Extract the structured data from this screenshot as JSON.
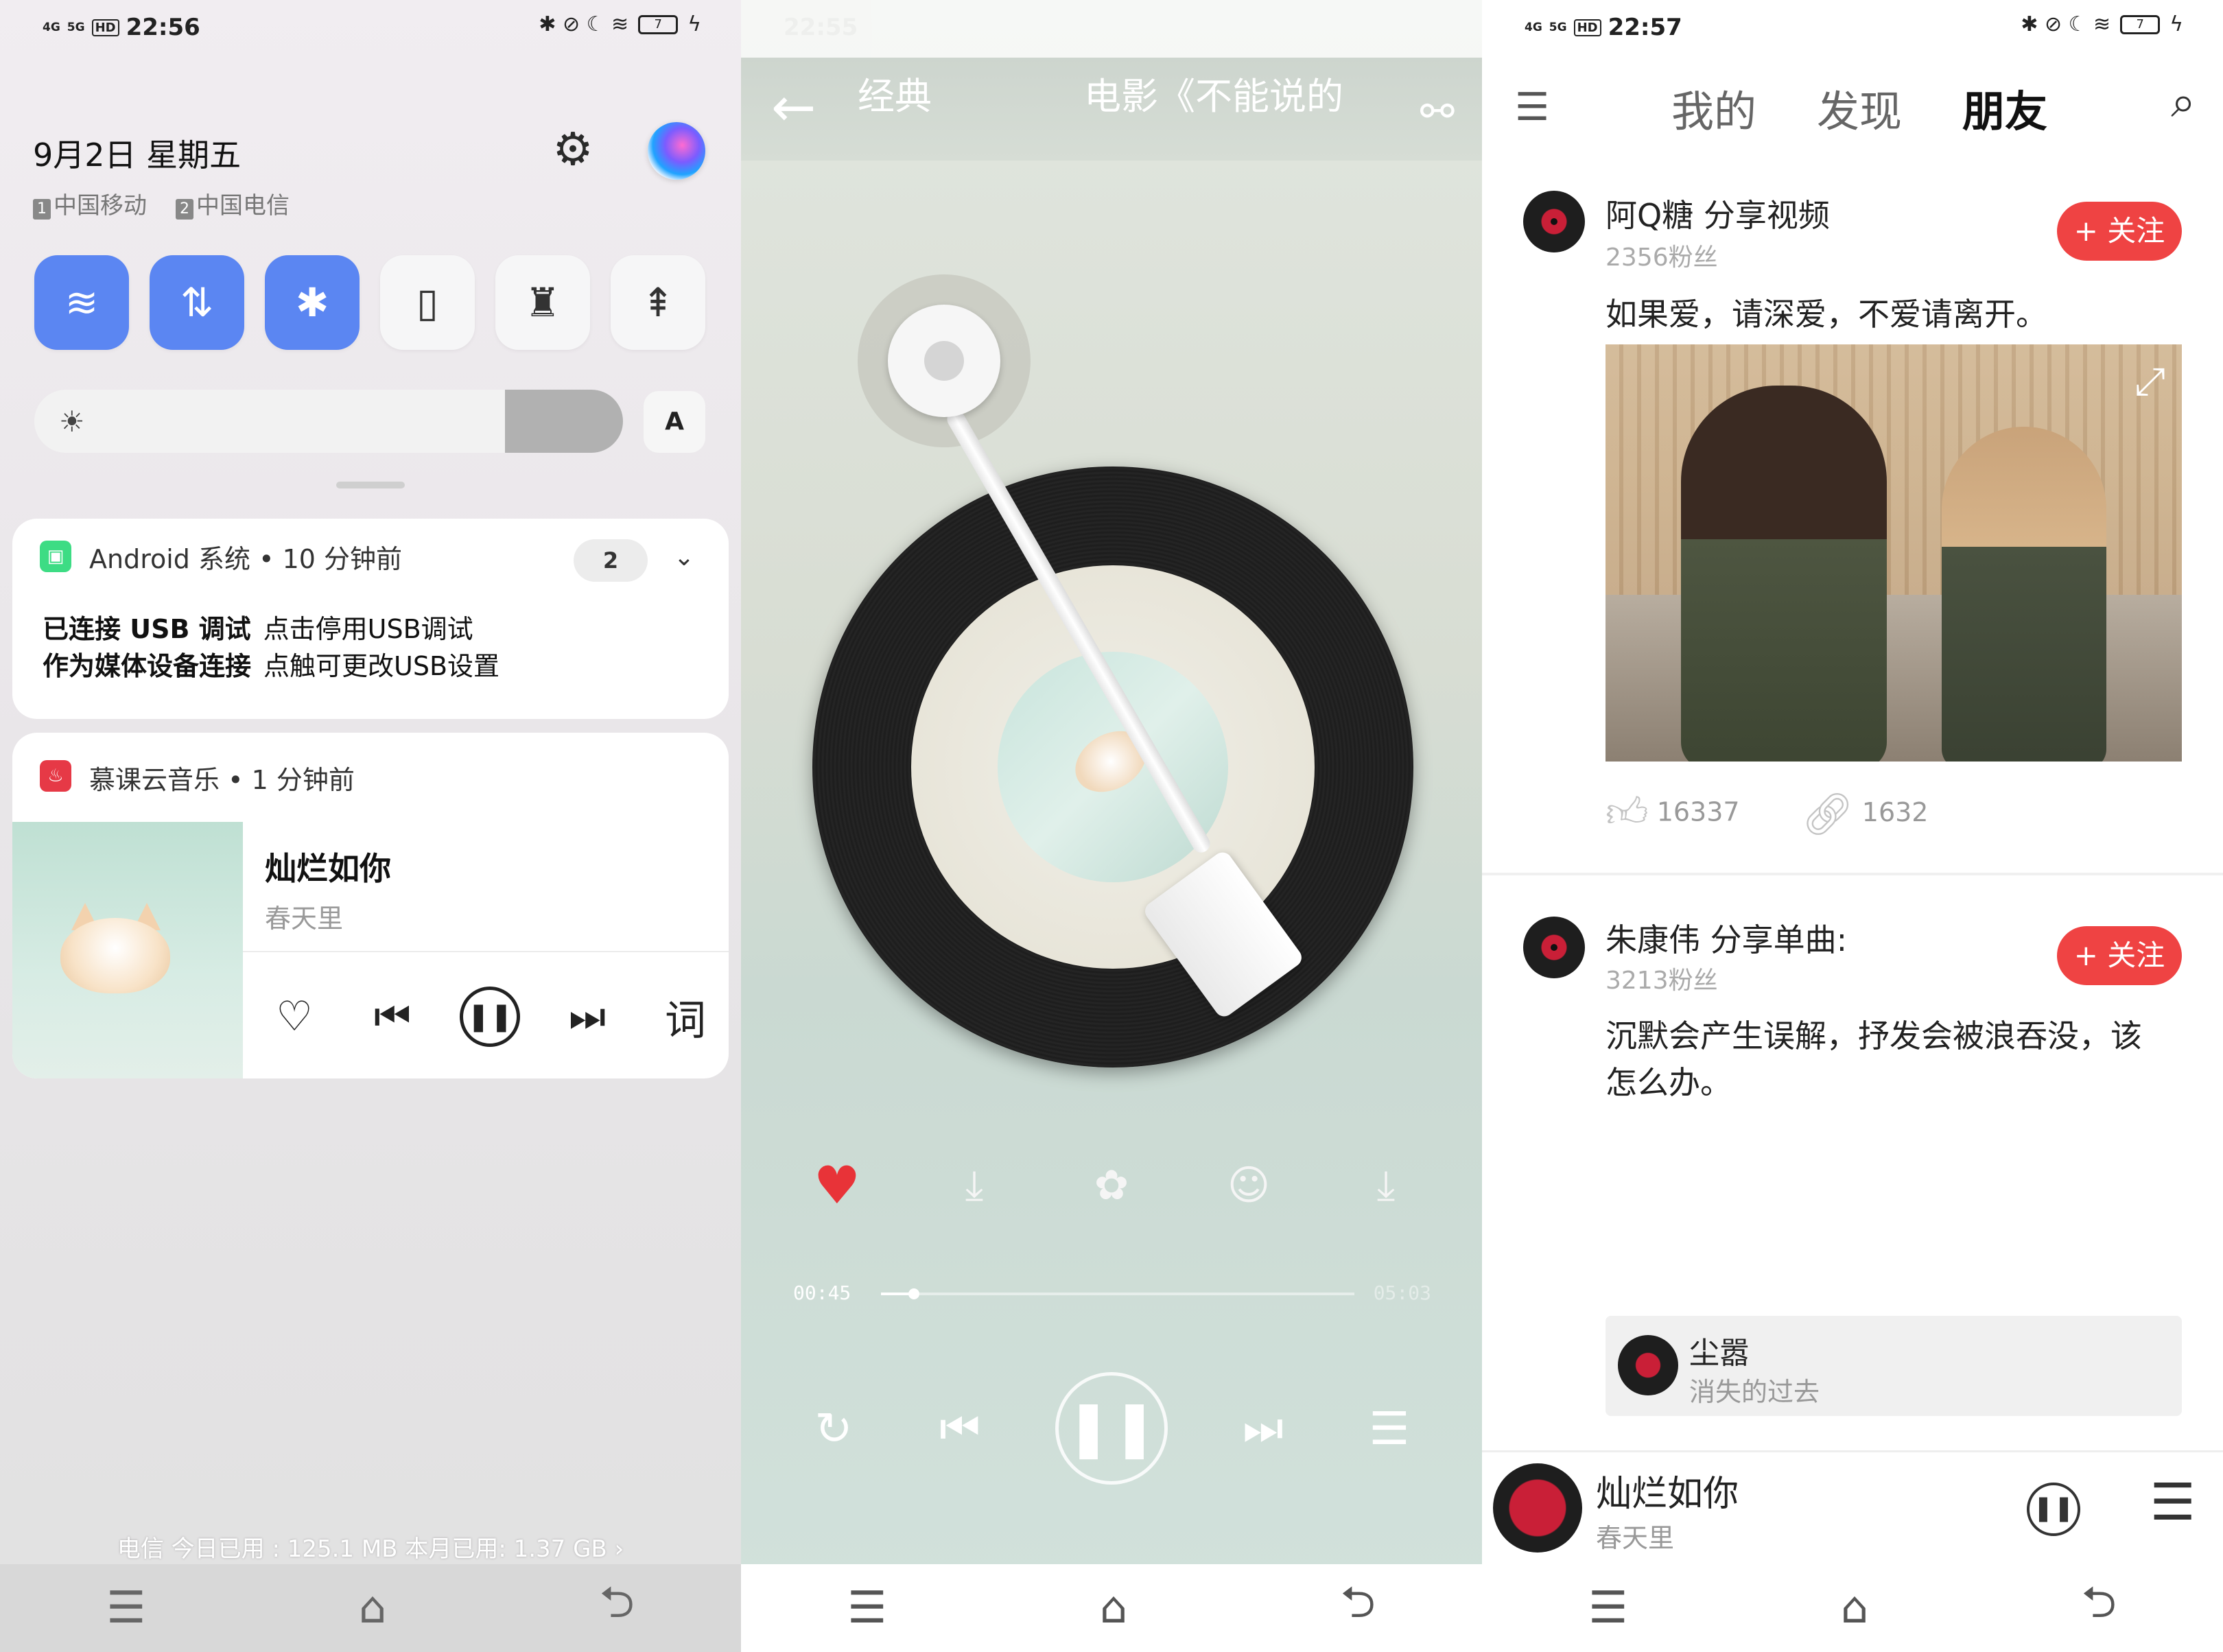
{
  "panel1": {
    "status": {
      "signal1": "4G",
      "signal2": "5G",
      "hd": "HD",
      "time": "22:56",
      "battery": "7",
      "right_icons": "✱ ⊘ ☾ ≋"
    },
    "date": "9月2日 星期五",
    "carriers": [
      {
        "sim": "1",
        "name": "中国移动"
      },
      {
        "sim": "2",
        "name": "中国电信"
      }
    ],
    "tiles": [
      {
        "icon": "wifi-icon",
        "glyph": "≋",
        "on": true
      },
      {
        "icon": "data-transfer-icon",
        "glyph": "⇅",
        "on": true
      },
      {
        "icon": "bluetooth-icon",
        "glyph": "✱",
        "on": true
      },
      {
        "icon": "vibrate-icon",
        "glyph": "▯",
        "on": false
      },
      {
        "icon": "flashlight-icon",
        "glyph": "♜",
        "on": false
      },
      {
        "icon": "rocket-icon",
        "glyph": "⇞",
        "on": false
      }
    ],
    "brightness": {
      "level": 0.2,
      "auto_label": "A"
    },
    "notif_android": {
      "header": "Android 系统 • 10 分钟前",
      "count": "2",
      "line1_bold": "已连接 USB 调试",
      "line1_text": "点击停用USB调试",
      "line2_bold": "作为媒体设备连接",
      "line2_text": "点触可更改USB设置"
    },
    "notif_music": {
      "header": "慕课云音乐 • 1 分钟前",
      "title": "灿烂如你",
      "artist": "春天里",
      "controls": {
        "like": "♡",
        "prev": "⏮",
        "pause": "❚❚",
        "next": "⏭",
        "lyrics": "词"
      }
    },
    "usage": "电信    今日已用 : 125.1 MB    本月已用: 1.37 GB ›",
    "nav": {
      "menu": "☰",
      "home": "⌂",
      "back": "⮌"
    }
  },
  "panel2": {
    "status": {
      "time": "22:55"
    },
    "title_left": "经典",
    "title_right": "电影《不能说的",
    "back": "←",
    "share": "⚯",
    "actions": {
      "like": "♥",
      "download": "⤓",
      "effect": "✿",
      "comment": "☺",
      "more": "⤓"
    },
    "progress": {
      "current": "00:45",
      "total": "05:03",
      "fraction": 0.07
    },
    "controls": {
      "repeat": "↻",
      "prev": "⏮",
      "pause": "❚❚",
      "next": "⏭",
      "playlist": "☰"
    },
    "nav": {
      "menu": "☰",
      "home": "⌂",
      "back": "⮌"
    }
  },
  "panel3": {
    "status": {
      "signal1": "4G",
      "signal2": "5G",
      "hd": "HD",
      "time": "22:57",
      "battery": "7",
      "right_icons": "✱ ⊘ ☾ ≋"
    },
    "tabs": [
      "我的",
      "发现",
      "朋友"
    ],
    "active_tab": "朋友",
    "posts": [
      {
        "name": "阿Q糖 分享视频",
        "fans": "2356粉丝",
        "follow": "+ 关注",
        "text": "如果爱，请深爱，不爱请离开。",
        "likes": "16337",
        "shares": "1632"
      },
      {
        "name": "朱康伟 分享单曲:",
        "fans": "3213粉丝",
        "follow": "+ 关注",
        "text": "沉默会产生误解，抒发会被浪吞没，该怎么办。",
        "song_title": "尘嚣",
        "song_sub": "消失的过去"
      }
    ],
    "mini_player": {
      "title": "灿烂如你",
      "artist": "春天里"
    },
    "nav": {
      "menu": "☰",
      "home": "⌂",
      "back": "⮌"
    }
  }
}
